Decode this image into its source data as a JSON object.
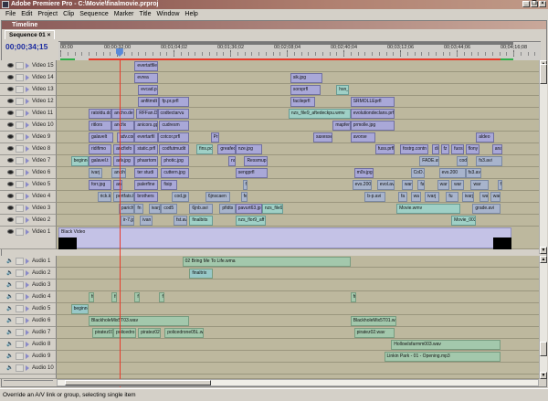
{
  "app": {
    "title": "Adobe Premiere Pro - C:\\Movie\\finalmovie.prproj"
  },
  "menu": [
    "File",
    "Edit",
    "Project",
    "Clip",
    "Sequence",
    "Marker",
    "Title",
    "Window",
    "Help"
  ],
  "panel": {
    "title": "Timeline",
    "tab": "Sequence 01",
    "tab_close": "×",
    "timecode": "00;00;34;15"
  },
  "ruler": {
    "labels": [
      {
        "t": 0,
        "text": "00;00"
      },
      {
        "t": 32,
        "text": "00;00;32;00"
      },
      {
        "t": 64,
        "text": "00;01;04;02"
      },
      {
        "t": 96,
        "text": "00;01;36;02"
      },
      {
        "t": 128,
        "text": "00;02;08;04"
      },
      {
        "t": 160,
        "text": "00;02;40;04"
      },
      {
        "t": 192,
        "text": "00;03;12;06"
      },
      {
        "t": 224,
        "text": "00;03;44;06"
      },
      {
        "t": 256,
        "text": "00;04;16;08"
      }
    ],
    "playhead_seconds": 34.5,
    "sequence_end_seconds": 256
  },
  "colors": {
    "video": "#a9a8d8",
    "teal": "#9fd0c6",
    "avi": "#a8b4cc",
    "audio": "#a3c8ac",
    "playhead": "#e83a2a",
    "timecode": "#1c2ca0"
  },
  "video_tracks": [
    {
      "name": "Video 15",
      "clips": [
        [
          "evertatfile",
          43,
          56
        ]
      ]
    },
    {
      "name": "Video 14",
      "clips": [
        [
          "evrea",
          43,
          56
        ],
        [
          "sik.jpg",
          131,
          149
        ]
      ]
    },
    {
      "name": "Video 13",
      "clips": [
        [
          "evcad.pr",
          45,
          56
        ],
        [
          "sorsprfl",
          131,
          148
        ],
        [
          "hsn_0",
          157,
          164,
          "teal"
        ]
      ]
    },
    {
      "name": "Video 12",
      "clips": [
        [
          "anfitmdt",
          45,
          57
        ],
        [
          "fp.pr.prfl",
          57,
          74
        ],
        [
          "facileprfl",
          131,
          145
        ],
        [
          "SRMOLLEprfl",
          165,
          190
        ]
      ]
    },
    {
      "name": "Video 11",
      "clips": [
        [
          "ratoldu.dc",
          17,
          30
        ],
        [
          "ancho.dei",
          30,
          43
        ],
        [
          "RFFan.D",
          44,
          56
        ],
        [
          "codtectarvu",
          56,
          74
        ],
        [
          "nzs_file9_aftedeckpu.wmv",
          130,
          165,
          "teal"
        ],
        [
          "evolutiondeclans.prfl",
          165,
          190
        ]
      ]
    },
    {
      "name": "Video 10",
      "clips": [
        [
          "ritlors",
          17,
          30
        ],
        [
          "ancfix",
          30,
          43
        ],
        [
          "anicors.gp",
          43,
          56
        ],
        [
          "cudresm",
          57,
          74
        ],
        [
          "mapfer",
          155,
          165
        ],
        [
          "prmolle.jpg",
          165,
          190
        ]
      ]
    },
    {
      "name": "Video 9",
      "clips": [
        [
          "galavelt",
          17,
          31
        ],
        [
          "adv.cor",
          33,
          43
        ],
        [
          "evertarfil",
          43,
          56
        ],
        [
          "cotcor.prfl",
          56,
          74
        ],
        [
          "Pri",
          86,
          91
        ],
        [
          "saxesse",
          144,
          155
        ],
        [
          "avorse",
          165,
          179
        ],
        [
          "aldeo",
          236,
          246
        ]
      ]
    },
    {
      "name": "Video 8",
      "clips": [
        [
          "ridifimo",
          17,
          30
        ],
        [
          "ancfixfo",
          31,
          43
        ],
        [
          "static.prfl",
          43,
          56
        ],
        [
          "codfutmudit",
          57,
          74
        ],
        [
          "fins.po",
          78,
          87,
          "teal"
        ],
        [
          "greafeo",
          90,
          100
        ],
        [
          "nze.jpg",
          100,
          115
        ],
        [
          "fuss.prfl",
          179,
          190
        ],
        [
          "fostrg.contn",
          193,
          209
        ],
        [
          "di",
          211,
          215
        ],
        [
          "fz",
          216,
          221
        ],
        [
          "fuosi",
          222,
          229
        ],
        [
          "flony",
          230,
          238
        ],
        [
          "ana",
          245,
          251
        ]
      ]
    },
    {
      "name": "Video 7",
      "clips": [
        [
          "beginng",
          7,
          17,
          "teal"
        ],
        [
          "galavel.t",
          17,
          30
        ],
        [
          "adv.jpg",
          31,
          43
        ],
        [
          "phasrtom",
          43,
          56
        ],
        [
          "photic.jpg",
          58,
          74
        ],
        [
          "ns",
          96,
          100
        ],
        [
          "Ressmup",
          105,
          118
        ],
        [
          "FADE.avi",
          204,
          215,
          "blue"
        ],
        [
          "cod8",
          225,
          231,
          "blue"
        ],
        [
          "fs3.avi",
          236,
          251,
          "blue"
        ]
      ]
    },
    {
      "name": "Video 6",
      "clips": [
        [
          "ivarj",
          17,
          25,
          "blue"
        ],
        [
          "ancih",
          30,
          38,
          "blue"
        ],
        [
          "ter studi",
          43,
          56
        ],
        [
          "cuttern.jpg",
          58,
          74
        ],
        [
          "sengprfl",
          100,
          118
        ],
        [
          "m0v.jpg",
          167,
          178
        ],
        [
          "CoD.i",
          199,
          207,
          "blue"
        ],
        [
          "evs.200",
          215,
          230,
          "blue"
        ],
        [
          "fs3.avi",
          230,
          239,
          "blue"
        ]
      ]
    },
    {
      "name": "Video 5",
      "clips": [
        [
          "forr.jpg",
          17,
          30
        ],
        [
          "ancl",
          31,
          36
        ],
        [
          "palerfine",
          43,
          56
        ],
        [
          "fisip",
          58,
          67
        ],
        [
          "fr",
          104,
          107,
          "blue"
        ],
        [
          "evs.200",
          166,
          177,
          "blue"
        ],
        [
          "evol.avi",
          180,
          190,
          "blue"
        ],
        [
          "war",
          194,
          200,
          "blue"
        ],
        [
          "fa",
          203,
          207,
          "blue"
        ],
        [
          "war",
          214,
          221,
          "blue"
        ],
        [
          "war",
          222,
          229,
          "blue"
        ],
        [
          "war",
          233,
          243,
          "blue"
        ],
        [
          "fa",
          248,
          251,
          "blue"
        ]
      ]
    },
    {
      "name": "Video 4",
      "clips": [
        [
          "rick.k",
          22,
          30,
          "blue"
        ],
        [
          "pertfats.t",
          31,
          43,
          "blue"
        ],
        [
          "brothers",
          43,
          56
        ],
        [
          "cod.jp",
          64,
          74,
          "blue"
        ],
        [
          "6jnscaen",
          83,
          97,
          "blue"
        ],
        [
          "fer",
          103,
          107,
          "blue"
        ],
        [
          "b-p.avi",
          173,
          185,
          "blue"
        ],
        [
          "fa",
          192,
          197,
          "blue"
        ],
        [
          "wa",
          199,
          205,
          "blue"
        ],
        [
          "ivarj",
          207,
          215,
          "blue"
        ],
        [
          "fu",
          219,
          226,
          "blue"
        ],
        [
          "ivarj",
          228,
          235,
          "blue"
        ],
        [
          "wa",
          238,
          243,
          "blue"
        ],
        [
          "war",
          244,
          250,
          "blue"
        ]
      ]
    },
    {
      "name": "Video 3",
      "clips": [
        [
          "parichi",
          34,
          43,
          "blue"
        ],
        [
          "fn",
          43,
          48,
          "blue"
        ],
        [
          "ivarj",
          51,
          58,
          "blue"
        ],
        [
          "cod5",
          58,
          67,
          "blue"
        ],
        [
          "6jnb.avi",
          74,
          87,
          "blue"
        ],
        [
          "pfidts",
          91,
          100,
          "blue"
        ],
        [
          "pavurt63.jp",
          100,
          115
        ],
        [
          "nzs_file9_c",
          115,
          127,
          "teal"
        ],
        [
          "Movie.wmv",
          191,
          227,
          "teal"
        ],
        [
          "grade.avi",
          234,
          250,
          "blue"
        ]
      ]
    },
    {
      "name": "Video 2",
      "clips": [
        [
          "ir-7.jp",
          35,
          43,
          "blue"
        ],
        [
          "ivan",
          46,
          53,
          "blue"
        ],
        [
          "fst.av",
          65,
          73,
          "blue"
        ],
        [
          "finalbits",
          74,
          87,
          "teal"
        ],
        [
          "nzs_flor9_aff",
          100,
          117,
          "teal"
        ],
        [
          "Movie_003",
          222,
          236,
          "teal"
        ]
      ]
    }
  ],
  "video1": {
    "name": "Video 1",
    "clip": "Black Video"
  },
  "audio_tracks": [
    {
      "name": "Audio 1",
      "clips": [
        [
          "02 Bring Me To Life.wma",
          70,
          165
        ]
      ]
    },
    {
      "name": "Audio 2",
      "clips": [
        [
          "finaltrix",
          74,
          87,
          "afile"
        ]
      ]
    },
    {
      "name": "Audio 3",
      "clips": []
    },
    {
      "name": "Audio 4",
      "clips": [
        [
          "fr",
          17,
          20
        ],
        [
          "fr",
          30,
          33
        ],
        [
          "fr",
          43,
          46
        ],
        [
          "fr",
          57,
          60
        ],
        [
          "fr",
          165,
          168
        ]
      ]
    },
    {
      "name": "Audio 5",
      "clips": [
        [
          "beginng",
          7,
          17,
          "afile"
        ]
      ]
    },
    {
      "name": "Audio 6",
      "clips": [
        [
          "BlackholeMix5T03.wav",
          17,
          74
        ],
        [
          "BlackholeMix5T01.wav",
          165,
          191
        ]
      ]
    },
    {
      "name": "Audio 7",
      "clips": [
        [
          "piratez01",
          19,
          31
        ],
        [
          "policedro",
          31,
          44
        ],
        [
          "piratez02",
          45,
          58
        ],
        [
          "policedrone05L.w",
          60,
          82
        ],
        [
          "piratez02.wav",
          167,
          190
        ]
      ]
    },
    {
      "name": "Audio 8",
      "clips": [
        [
          "HollowIsfarmm003.wav",
          188,
          250
        ]
      ]
    },
    {
      "name": "Audio 9",
      "clips": [
        [
          "Linkin Park - 01 - Opening.mp3",
          184,
          250
        ]
      ]
    },
    {
      "name": "Audio 10",
      "clips": []
    }
  ],
  "status": "Override an A/V link or group, selecting single item"
}
